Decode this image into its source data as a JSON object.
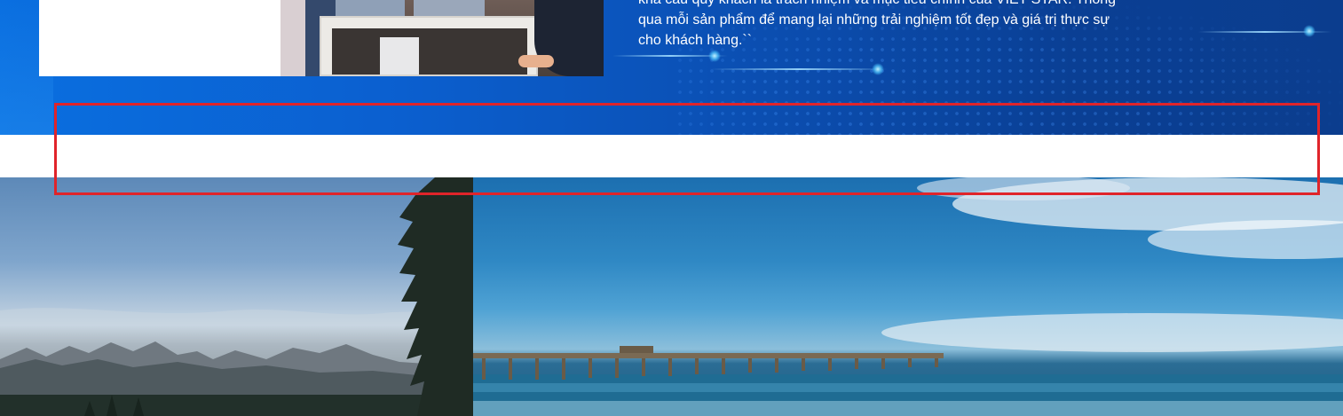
{
  "hero": {
    "quote_lines": [
      "khả cấu quý khách là trách nhiệm và mục tiêu chính của VIET STAR. Thông",
      "qua mỗi sản phẩm để mang lại những trải nghiệm tốt đẹp và giá trị thực sự",
      "cho khách hàng.``"
    ]
  },
  "images": {
    "top_photo": "group-photo",
    "bottom_left": "mountain-landscape",
    "bottom_right": "ocean-pier"
  },
  "colors": {
    "hero_blue": "#0b5fcf",
    "highlight_red": "#e0242a"
  }
}
